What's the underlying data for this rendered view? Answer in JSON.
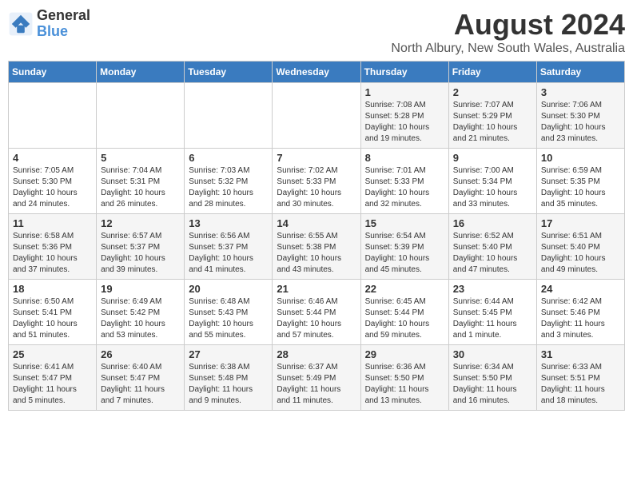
{
  "logo": {
    "line1": "General",
    "line2": "Blue"
  },
  "title": "August 2024",
  "subtitle": "North Albury, New South Wales, Australia",
  "days_of_week": [
    "Sunday",
    "Monday",
    "Tuesday",
    "Wednesday",
    "Thursday",
    "Friday",
    "Saturday"
  ],
  "weeks": [
    [
      {
        "day": "",
        "info": ""
      },
      {
        "day": "",
        "info": ""
      },
      {
        "day": "",
        "info": ""
      },
      {
        "day": "",
        "info": ""
      },
      {
        "day": "1",
        "info": "Sunrise: 7:08 AM\nSunset: 5:28 PM\nDaylight: 10 hours and 19 minutes."
      },
      {
        "day": "2",
        "info": "Sunrise: 7:07 AM\nSunset: 5:29 PM\nDaylight: 10 hours and 21 minutes."
      },
      {
        "day": "3",
        "info": "Sunrise: 7:06 AM\nSunset: 5:30 PM\nDaylight: 10 hours and 23 minutes."
      }
    ],
    [
      {
        "day": "4",
        "info": "Sunrise: 7:05 AM\nSunset: 5:30 PM\nDaylight: 10 hours and 24 minutes."
      },
      {
        "day": "5",
        "info": "Sunrise: 7:04 AM\nSunset: 5:31 PM\nDaylight: 10 hours and 26 minutes."
      },
      {
        "day": "6",
        "info": "Sunrise: 7:03 AM\nSunset: 5:32 PM\nDaylight: 10 hours and 28 minutes."
      },
      {
        "day": "7",
        "info": "Sunrise: 7:02 AM\nSunset: 5:33 PM\nDaylight: 10 hours and 30 minutes."
      },
      {
        "day": "8",
        "info": "Sunrise: 7:01 AM\nSunset: 5:33 PM\nDaylight: 10 hours and 32 minutes."
      },
      {
        "day": "9",
        "info": "Sunrise: 7:00 AM\nSunset: 5:34 PM\nDaylight: 10 hours and 33 minutes."
      },
      {
        "day": "10",
        "info": "Sunrise: 6:59 AM\nSunset: 5:35 PM\nDaylight: 10 hours and 35 minutes."
      }
    ],
    [
      {
        "day": "11",
        "info": "Sunrise: 6:58 AM\nSunset: 5:36 PM\nDaylight: 10 hours and 37 minutes."
      },
      {
        "day": "12",
        "info": "Sunrise: 6:57 AM\nSunset: 5:37 PM\nDaylight: 10 hours and 39 minutes."
      },
      {
        "day": "13",
        "info": "Sunrise: 6:56 AM\nSunset: 5:37 PM\nDaylight: 10 hours and 41 minutes."
      },
      {
        "day": "14",
        "info": "Sunrise: 6:55 AM\nSunset: 5:38 PM\nDaylight: 10 hours and 43 minutes."
      },
      {
        "day": "15",
        "info": "Sunrise: 6:54 AM\nSunset: 5:39 PM\nDaylight: 10 hours and 45 minutes."
      },
      {
        "day": "16",
        "info": "Sunrise: 6:52 AM\nSunset: 5:40 PM\nDaylight: 10 hours and 47 minutes."
      },
      {
        "day": "17",
        "info": "Sunrise: 6:51 AM\nSunset: 5:40 PM\nDaylight: 10 hours and 49 minutes."
      }
    ],
    [
      {
        "day": "18",
        "info": "Sunrise: 6:50 AM\nSunset: 5:41 PM\nDaylight: 10 hours and 51 minutes."
      },
      {
        "day": "19",
        "info": "Sunrise: 6:49 AM\nSunset: 5:42 PM\nDaylight: 10 hours and 53 minutes."
      },
      {
        "day": "20",
        "info": "Sunrise: 6:48 AM\nSunset: 5:43 PM\nDaylight: 10 hours and 55 minutes."
      },
      {
        "day": "21",
        "info": "Sunrise: 6:46 AM\nSunset: 5:44 PM\nDaylight: 10 hours and 57 minutes."
      },
      {
        "day": "22",
        "info": "Sunrise: 6:45 AM\nSunset: 5:44 PM\nDaylight: 10 hours and 59 minutes."
      },
      {
        "day": "23",
        "info": "Sunrise: 6:44 AM\nSunset: 5:45 PM\nDaylight: 11 hours and 1 minute."
      },
      {
        "day": "24",
        "info": "Sunrise: 6:42 AM\nSunset: 5:46 PM\nDaylight: 11 hours and 3 minutes."
      }
    ],
    [
      {
        "day": "25",
        "info": "Sunrise: 6:41 AM\nSunset: 5:47 PM\nDaylight: 11 hours and 5 minutes."
      },
      {
        "day": "26",
        "info": "Sunrise: 6:40 AM\nSunset: 5:47 PM\nDaylight: 11 hours and 7 minutes."
      },
      {
        "day": "27",
        "info": "Sunrise: 6:38 AM\nSunset: 5:48 PM\nDaylight: 11 hours and 9 minutes."
      },
      {
        "day": "28",
        "info": "Sunrise: 6:37 AM\nSunset: 5:49 PM\nDaylight: 11 hours and 11 minutes."
      },
      {
        "day": "29",
        "info": "Sunrise: 6:36 AM\nSunset: 5:50 PM\nDaylight: 11 hours and 13 minutes."
      },
      {
        "day": "30",
        "info": "Sunrise: 6:34 AM\nSunset: 5:50 PM\nDaylight: 11 hours and 16 minutes."
      },
      {
        "day": "31",
        "info": "Sunrise: 6:33 AM\nSunset: 5:51 PM\nDaylight: 11 hours and 18 minutes."
      }
    ]
  ]
}
